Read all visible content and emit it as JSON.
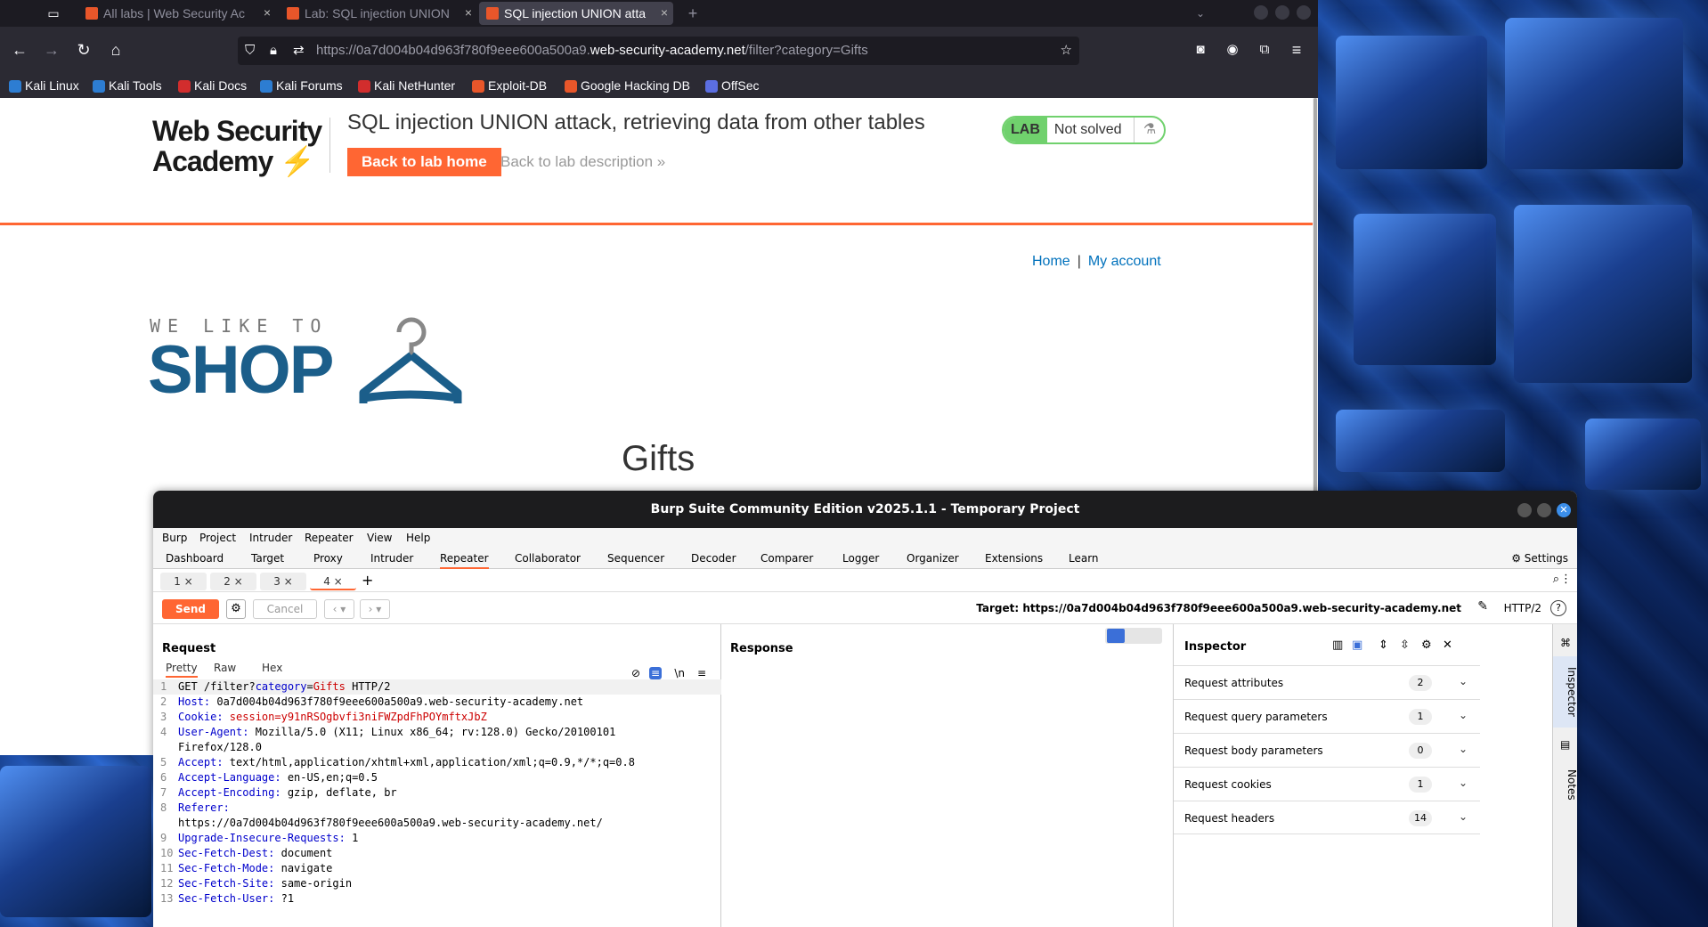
{
  "browser": {
    "tabs": [
      {
        "label": "All labs | Web Security Ac"
      },
      {
        "label": "Lab: SQL injection UNION"
      },
      {
        "label": "SQL injection UNION atta"
      }
    ],
    "new_tab": "+",
    "url_prefix": "https://0a7d004b04d963f780f9eee600a500a9.",
    "url_host": "web-security-academy.net",
    "url_path": "/filter?category=Gifts",
    "bookmarks": [
      {
        "label": "Kali Linux",
        "color": "#2d7dd2"
      },
      {
        "label": "Kali Tools",
        "color": "#2d7dd2"
      },
      {
        "label": "Kali Docs",
        "color": "#d22d2d"
      },
      {
        "label": "Kali Forums",
        "color": "#2d7dd2"
      },
      {
        "label": "Kali NetHunter",
        "color": "#d22d2d"
      },
      {
        "label": "Exploit-DB",
        "color": "#e8562a"
      },
      {
        "label": "Google Hacking DB",
        "color": "#e8562a"
      },
      {
        "label": "OffSec",
        "color": "#5b6ee1"
      }
    ]
  },
  "page": {
    "logo_line1": "Web Security",
    "logo_line2": "Academy",
    "lab_title": "SQL injection UNION attack, retrieving data from other tables",
    "back_to_lab_home": "Back to lab home",
    "back_to_lab_description": "Back to lab description",
    "lab_badge": "LAB",
    "lab_status": "Not solved",
    "nav_home": "Home",
    "nav_sep": "|",
    "nav_account": "My account",
    "shop_small": "WE LIKE TO",
    "shop_big": "SHOP",
    "category_title": "Gifts",
    "accent_color": "#ff6633"
  },
  "burp": {
    "title": "Burp Suite Community Edition v2025.1.1 - Temporary Project",
    "menu": [
      "Burp",
      "Project",
      "Intruder",
      "Repeater",
      "View",
      "Help"
    ],
    "tabs": [
      "Dashboard",
      "Target",
      "Proxy",
      "Intruder",
      "Repeater",
      "Collaborator",
      "Sequencer",
      "Decoder",
      "Comparer",
      "Logger",
      "Organizer",
      "Extensions",
      "Learn"
    ],
    "active_tab": "Repeater",
    "settings": "Settings",
    "repeater_tabs": [
      "1 ×",
      "2 ×",
      "3 ×",
      "4 ×"
    ],
    "send": "Send",
    "cancel": "Cancel",
    "target": "Target: https://0a7d004b04d963f780f9eee600a500a9.web-security-academy.net",
    "http_version": "HTTP/2",
    "request_title": "Request",
    "response_title": "Response",
    "request_subtabs": [
      "Pretty",
      "Raw",
      "Hex"
    ],
    "request_lines": [
      {
        "n": "1",
        "k": "",
        "v": "",
        "raw": "GET /filter?category=Gifts HTTP/2"
      },
      {
        "n": "2",
        "k": "Host:",
        "v": "",
        "raw": " 0a7d004b04d963f780f9eee600a500a9.web-security-academy.net"
      },
      {
        "n": "3",
        "k": "Cookie:",
        "v": " session=y91nRSOgbvfi3niFWZpdFhPOYmftxJbZ",
        "raw": ""
      },
      {
        "n": "4",
        "k": "User-Agent:",
        "v": "",
        "raw": " Mozilla/5.0 (X11; Linux x86_64; rv:128.0) Gecko/20100101"
      },
      {
        "n": "",
        "k": "",
        "v": "",
        "raw": "Firefox/128.0"
      },
      {
        "n": "5",
        "k": "Accept:",
        "v": "",
        "raw": " text/html,application/xhtml+xml,application/xml;q=0.9,*/*;q=0.8"
      },
      {
        "n": "6",
        "k": "Accept-Language:",
        "v": "",
        "raw": " en-US,en;q=0.5"
      },
      {
        "n": "7",
        "k": "Accept-Encoding:",
        "v": "",
        "raw": " gzip, deflate, br"
      },
      {
        "n": "8",
        "k": "Referer:",
        "v": "",
        "raw": ""
      },
      {
        "n": "",
        "k": "",
        "v": "",
        "raw": "https://0a7d004b04d963f780f9eee600a500a9.web-security-academy.net/"
      },
      {
        "n": "9",
        "k": "Upgrade-Insecure-Requests:",
        "v": "",
        "raw": " 1"
      },
      {
        "n": "10",
        "k": "Sec-Fetch-Dest:",
        "v": "",
        "raw": " document"
      },
      {
        "n": "11",
        "k": "Sec-Fetch-Mode:",
        "v": "",
        "raw": " navigate"
      },
      {
        "n": "12",
        "k": "Sec-Fetch-Site:",
        "v": "",
        "raw": " same-origin"
      },
      {
        "n": "13",
        "k": "Sec-Fetch-User:",
        "v": "",
        "raw": " ?1"
      }
    ],
    "inspector_title": "Inspector",
    "inspector_rows": [
      {
        "label": "Request attributes",
        "count": "2"
      },
      {
        "label": "Request query parameters",
        "count": "1"
      },
      {
        "label": "Request body parameters",
        "count": "0"
      },
      {
        "label": "Request cookies",
        "count": "1"
      },
      {
        "label": "Request headers",
        "count": "14"
      }
    ],
    "side_inspector": "Inspector",
    "side_notes": "Notes"
  }
}
